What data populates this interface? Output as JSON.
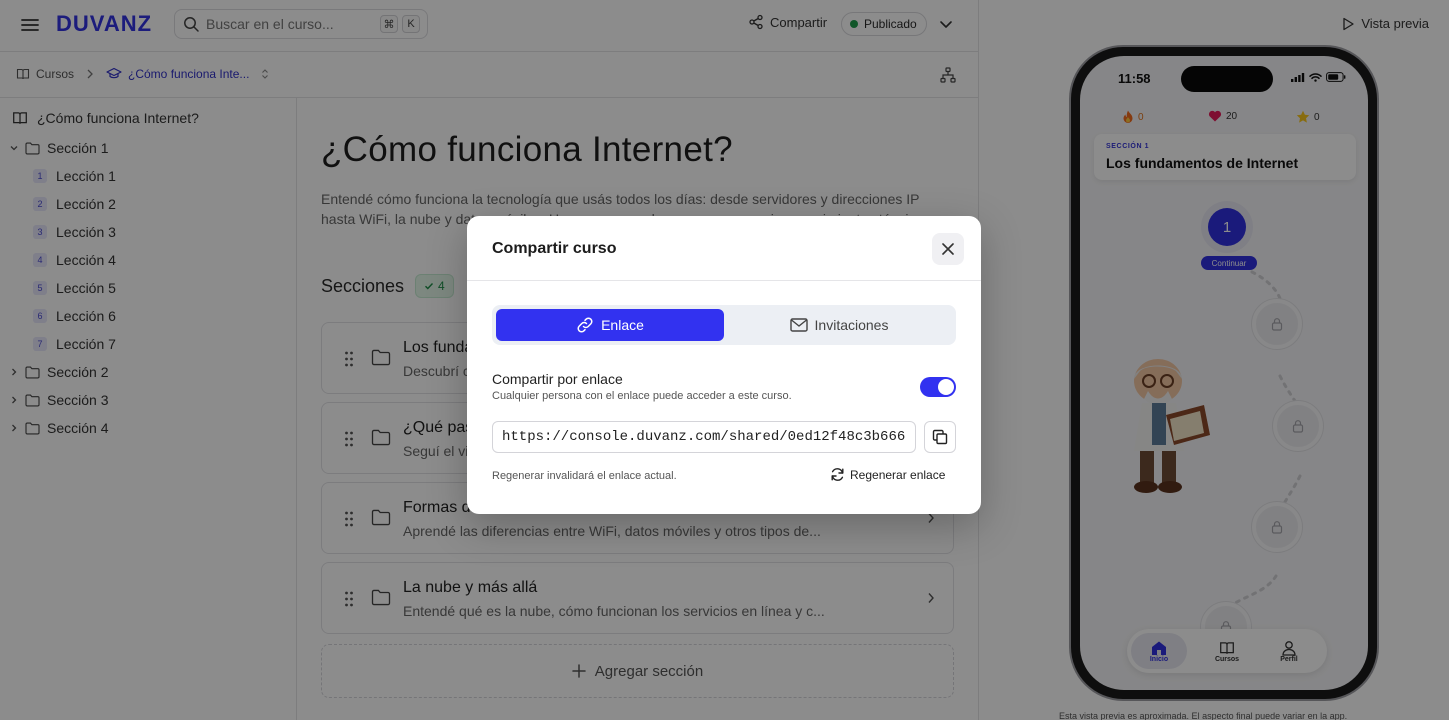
{
  "app": {
    "logo": "DUVANZ"
  },
  "search": {
    "placeholder": "Buscar en el curso...",
    "kbd_mod": "⌘",
    "kbd_key": "K"
  },
  "header": {
    "share_label": "Compartir",
    "status_label": "Publicado",
    "status_color": "#1f9d4c",
    "preview_label": "Vista previa"
  },
  "breadcrumb": {
    "root": "Cursos",
    "current": "¿Cómo funciona Inte..."
  },
  "sidebar": {
    "course": "¿Cómo funciona Internet?",
    "sections": [
      {
        "label": "Sección 1",
        "expanded": true,
        "lessons": [
          {
            "num": "1",
            "label": "Lección 1"
          },
          {
            "num": "2",
            "label": "Lección 2"
          },
          {
            "num": "3",
            "label": "Lección 3"
          },
          {
            "num": "4",
            "label": "Lección 4"
          },
          {
            "num": "5",
            "label": "Lección 5"
          },
          {
            "num": "6",
            "label": "Lección 6"
          },
          {
            "num": "7",
            "label": "Lección 7"
          }
        ]
      },
      {
        "label": "Sección 2",
        "expanded": false
      },
      {
        "label": "Sección 3",
        "expanded": false
      },
      {
        "label": "Sección 4",
        "expanded": false
      }
    ]
  },
  "main": {
    "title": "¿Cómo funciona Internet?",
    "description": "Entendé cómo funciona la tecnología que usás todos los días: desde servidores y direcciones IP hasta WiFi, la nube y datos móviles. Un curso pensado para comenzar sin conocimientos técnicos.",
    "sections_heading": "Secciones",
    "sections_count": "4",
    "cards": [
      {
        "title": "Los fundamentos de Internet",
        "desc": "Descubrí cómo funciona la red que conecta el mundo..."
      },
      {
        "title": "¿Qué pasa cuando navegás?",
        "desc": "Seguí el viaje de una página web desde el servidor..."
      },
      {
        "title": "Formas de conectarse",
        "desc": "Aprendé las diferencias entre WiFi, datos móviles y otros tipos de..."
      },
      {
        "title": "La nube y más allá",
        "desc": "Entendé qué es la nube, cómo funcionan los servicios en línea y c..."
      }
    ],
    "add_section_label": "Agregar sección"
  },
  "phone": {
    "time": "11:58",
    "streak": "0",
    "lives": "20",
    "stars": "0",
    "section_kicker": "SECCIÓN 1",
    "section_title": "Los fundamentos de Internet",
    "current_node": "1",
    "continue_label": "Continuar",
    "nav": [
      {
        "label": "Inicio",
        "active": true
      },
      {
        "label": "Cursos",
        "active": false
      },
      {
        "label": "Perfil",
        "active": false
      }
    ],
    "disclaimer": "Esta vista previa es aproximada. El aspecto final puede variar en la app."
  },
  "modal": {
    "title": "Compartir curso",
    "tabs": [
      {
        "label": "Enlace",
        "active": true
      },
      {
        "label": "Invitaciones",
        "active": false
      }
    ],
    "share_link_title": "Compartir por enlace",
    "share_link_subtitle": "Cualquier persona con el enlace puede acceder a este curso.",
    "toggle_on": true,
    "link_value": "https://console.duvanz.com/shared/0ed12f48c3b666",
    "regen_note": "Regenerar invalidará el enlace actual.",
    "regen_label": "Regenerar enlace"
  },
  "colors": {
    "accent": "#3232f0",
    "brand": "#3434e2",
    "success": "#1f9d4c"
  }
}
